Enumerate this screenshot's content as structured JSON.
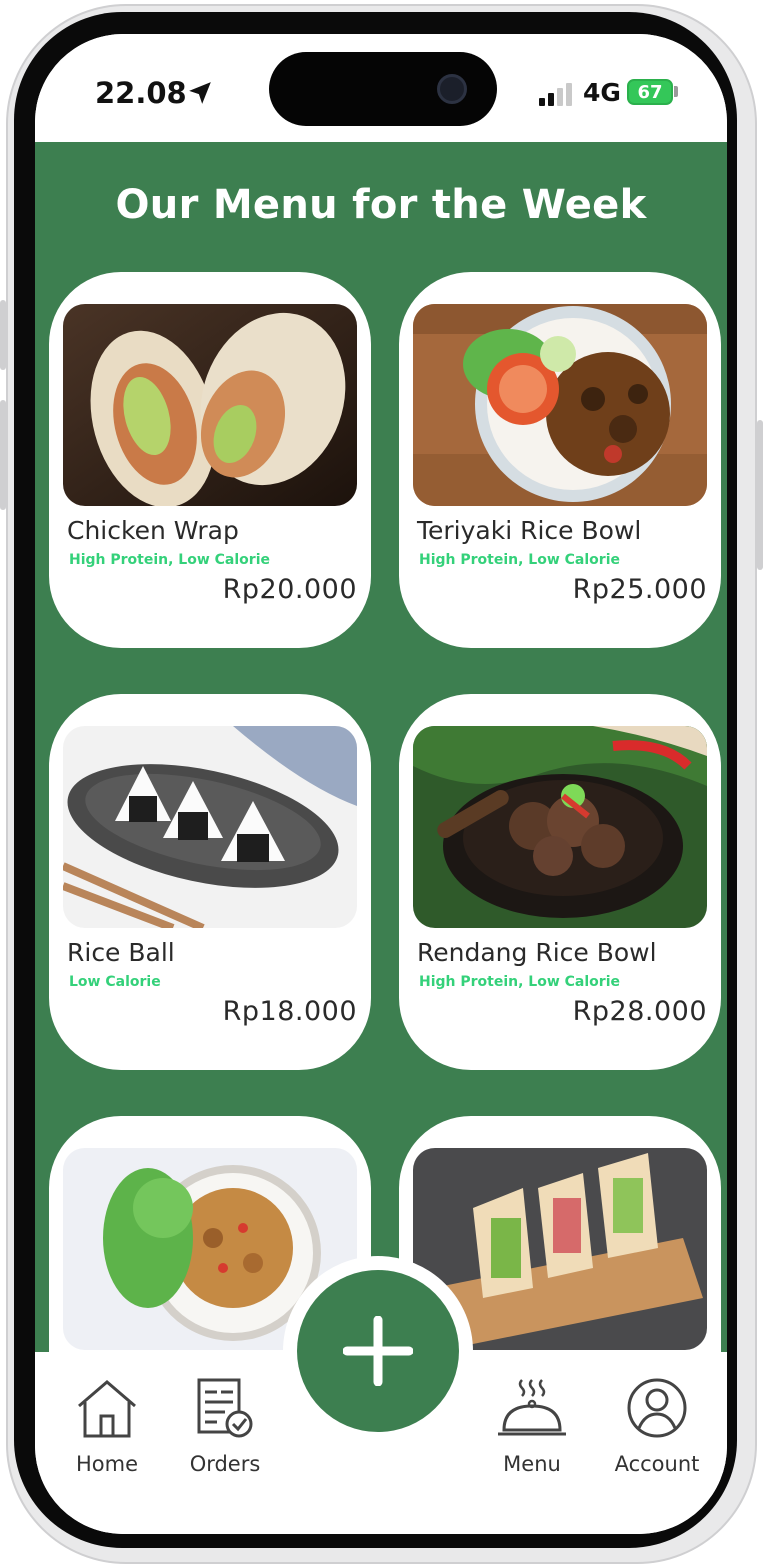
{
  "status_bar": {
    "time": "22.08",
    "network": "4G",
    "battery": "67"
  },
  "page": {
    "title": "Our Menu for the Week"
  },
  "menu_items": [
    {
      "name": "Chicken Wrap",
      "tags": "High Protein, Low Calorie",
      "price": "Rp20.000"
    },
    {
      "name": "Teriyaki Rice Bowl",
      "tags": "High Protein, Low Calorie",
      "price": "Rp25.000"
    },
    {
      "name": "Rice Ball",
      "tags": "Low Calorie",
      "price": "Rp18.000"
    },
    {
      "name": "Rendang Rice Bowl",
      "tags": "High Protein, Low Calorie",
      "price": "Rp28.000"
    }
  ],
  "bottom_nav": {
    "items": [
      {
        "label": "Home",
        "icon": "home-icon"
      },
      {
        "label": "Orders",
        "icon": "orders-icon"
      },
      {
        "label": "Menu",
        "icon": "cloche-icon"
      },
      {
        "label": "Account",
        "icon": "account-icon"
      }
    ],
    "fab_icon": "plus-icon"
  },
  "colors": {
    "primary_green": "#3d7f50",
    "tag_green": "#34d17a",
    "battery_green": "#34c759"
  }
}
